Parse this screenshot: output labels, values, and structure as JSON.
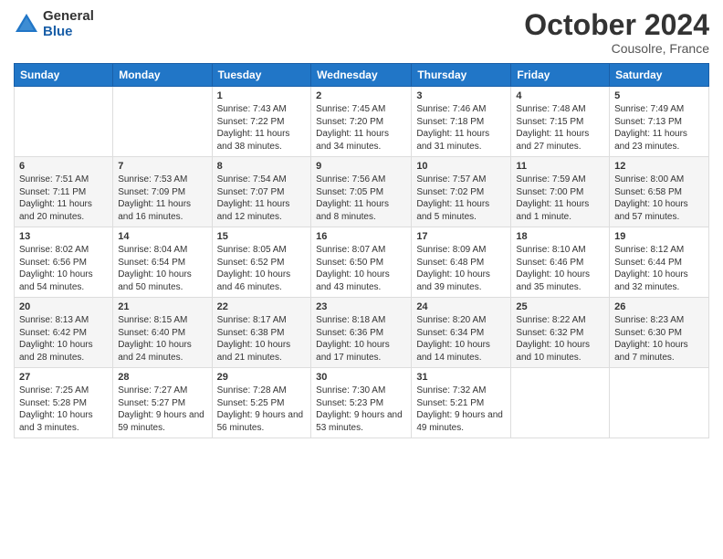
{
  "header": {
    "logo_general": "General",
    "logo_blue": "Blue",
    "month_title": "October 2024",
    "location": "Cousolre, France"
  },
  "weekdays": [
    "Sunday",
    "Monday",
    "Tuesday",
    "Wednesday",
    "Thursday",
    "Friday",
    "Saturday"
  ],
  "weeks": [
    [
      {
        "day": "",
        "info": ""
      },
      {
        "day": "",
        "info": ""
      },
      {
        "day": "1",
        "info": "Sunrise: 7:43 AM\nSunset: 7:22 PM\nDaylight: 11 hours and 38 minutes."
      },
      {
        "day": "2",
        "info": "Sunrise: 7:45 AM\nSunset: 7:20 PM\nDaylight: 11 hours and 34 minutes."
      },
      {
        "day": "3",
        "info": "Sunrise: 7:46 AM\nSunset: 7:18 PM\nDaylight: 11 hours and 31 minutes."
      },
      {
        "day": "4",
        "info": "Sunrise: 7:48 AM\nSunset: 7:15 PM\nDaylight: 11 hours and 27 minutes."
      },
      {
        "day": "5",
        "info": "Sunrise: 7:49 AM\nSunset: 7:13 PM\nDaylight: 11 hours and 23 minutes."
      }
    ],
    [
      {
        "day": "6",
        "info": "Sunrise: 7:51 AM\nSunset: 7:11 PM\nDaylight: 11 hours and 20 minutes."
      },
      {
        "day": "7",
        "info": "Sunrise: 7:53 AM\nSunset: 7:09 PM\nDaylight: 11 hours and 16 minutes."
      },
      {
        "day": "8",
        "info": "Sunrise: 7:54 AM\nSunset: 7:07 PM\nDaylight: 11 hours and 12 minutes."
      },
      {
        "day": "9",
        "info": "Sunrise: 7:56 AM\nSunset: 7:05 PM\nDaylight: 11 hours and 8 minutes."
      },
      {
        "day": "10",
        "info": "Sunrise: 7:57 AM\nSunset: 7:02 PM\nDaylight: 11 hours and 5 minutes."
      },
      {
        "day": "11",
        "info": "Sunrise: 7:59 AM\nSunset: 7:00 PM\nDaylight: 11 hours and 1 minute."
      },
      {
        "day": "12",
        "info": "Sunrise: 8:00 AM\nSunset: 6:58 PM\nDaylight: 10 hours and 57 minutes."
      }
    ],
    [
      {
        "day": "13",
        "info": "Sunrise: 8:02 AM\nSunset: 6:56 PM\nDaylight: 10 hours and 54 minutes."
      },
      {
        "day": "14",
        "info": "Sunrise: 8:04 AM\nSunset: 6:54 PM\nDaylight: 10 hours and 50 minutes."
      },
      {
        "day": "15",
        "info": "Sunrise: 8:05 AM\nSunset: 6:52 PM\nDaylight: 10 hours and 46 minutes."
      },
      {
        "day": "16",
        "info": "Sunrise: 8:07 AM\nSunset: 6:50 PM\nDaylight: 10 hours and 43 minutes."
      },
      {
        "day": "17",
        "info": "Sunrise: 8:09 AM\nSunset: 6:48 PM\nDaylight: 10 hours and 39 minutes."
      },
      {
        "day": "18",
        "info": "Sunrise: 8:10 AM\nSunset: 6:46 PM\nDaylight: 10 hours and 35 minutes."
      },
      {
        "day": "19",
        "info": "Sunrise: 8:12 AM\nSunset: 6:44 PM\nDaylight: 10 hours and 32 minutes."
      }
    ],
    [
      {
        "day": "20",
        "info": "Sunrise: 8:13 AM\nSunset: 6:42 PM\nDaylight: 10 hours and 28 minutes."
      },
      {
        "day": "21",
        "info": "Sunrise: 8:15 AM\nSunset: 6:40 PM\nDaylight: 10 hours and 24 minutes."
      },
      {
        "day": "22",
        "info": "Sunrise: 8:17 AM\nSunset: 6:38 PM\nDaylight: 10 hours and 21 minutes."
      },
      {
        "day": "23",
        "info": "Sunrise: 8:18 AM\nSunset: 6:36 PM\nDaylight: 10 hours and 17 minutes."
      },
      {
        "day": "24",
        "info": "Sunrise: 8:20 AM\nSunset: 6:34 PM\nDaylight: 10 hours and 14 minutes."
      },
      {
        "day": "25",
        "info": "Sunrise: 8:22 AM\nSunset: 6:32 PM\nDaylight: 10 hours and 10 minutes."
      },
      {
        "day": "26",
        "info": "Sunrise: 8:23 AM\nSunset: 6:30 PM\nDaylight: 10 hours and 7 minutes."
      }
    ],
    [
      {
        "day": "27",
        "info": "Sunrise: 7:25 AM\nSunset: 5:28 PM\nDaylight: 10 hours and 3 minutes."
      },
      {
        "day": "28",
        "info": "Sunrise: 7:27 AM\nSunset: 5:27 PM\nDaylight: 9 hours and 59 minutes."
      },
      {
        "day": "29",
        "info": "Sunrise: 7:28 AM\nSunset: 5:25 PM\nDaylight: 9 hours and 56 minutes."
      },
      {
        "day": "30",
        "info": "Sunrise: 7:30 AM\nSunset: 5:23 PM\nDaylight: 9 hours and 53 minutes."
      },
      {
        "day": "31",
        "info": "Sunrise: 7:32 AM\nSunset: 5:21 PM\nDaylight: 9 hours and 49 minutes."
      },
      {
        "day": "",
        "info": ""
      },
      {
        "day": "",
        "info": ""
      }
    ]
  ]
}
